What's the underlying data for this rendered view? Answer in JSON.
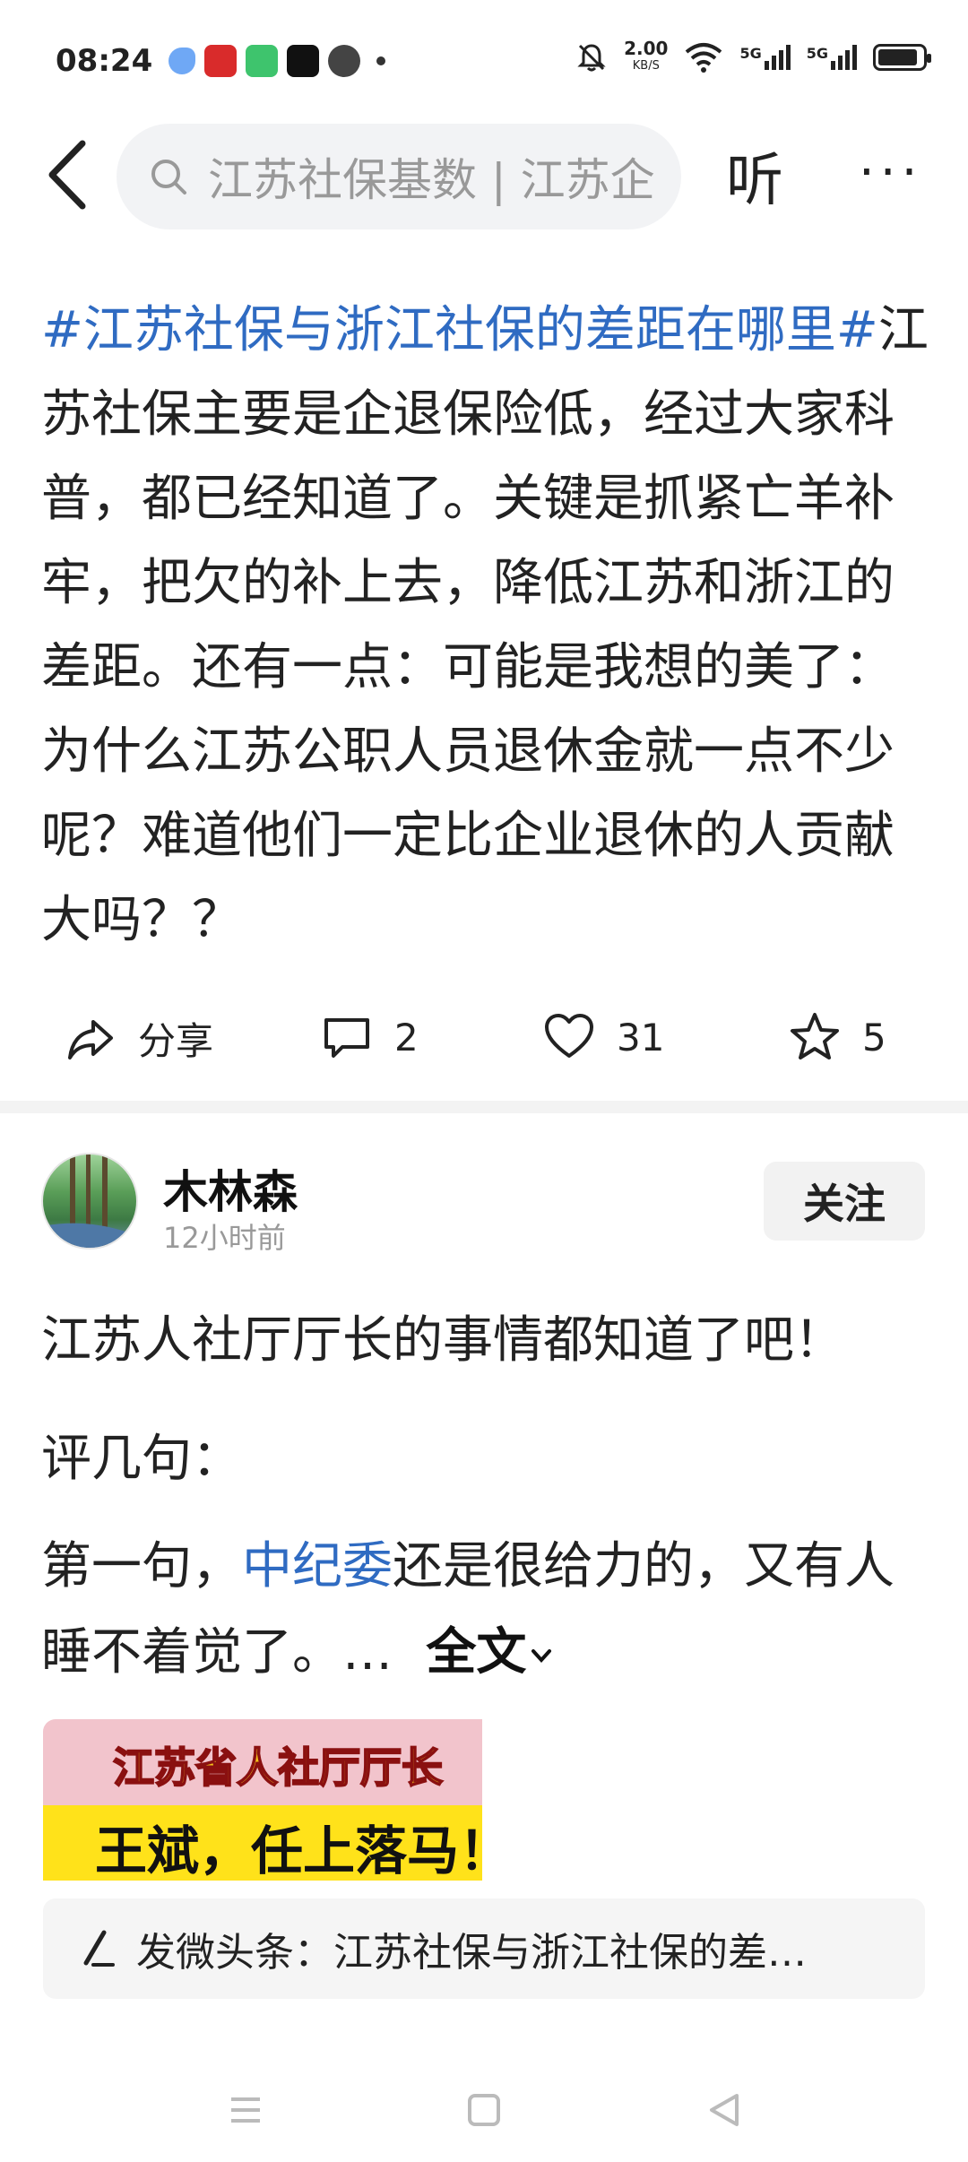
{
  "status_bar": {
    "time": "08:24",
    "net_speed_value": "2.00",
    "net_speed_unit": "KB/S",
    "signal_label_1": "5G",
    "signal_label_2": "5G",
    "battery_level": 0.9
  },
  "top_nav": {
    "search_placeholder": "江苏社保基数 | 江苏企",
    "listen_label": "听",
    "more_label": "···"
  },
  "post": {
    "hashtag": "#江苏社保与浙江社保的差距在哪里#",
    "body": "江苏社保主要是企退保险低，经过大家科普，都已经知道了。关键是抓紧亡羊补牢，把欠的补上去，降低江苏和浙江的差距。还有一点：可能是我想的美了：为什么江苏公职人员退休金就一点不少呢？难道他们一定比企业退休的人贡献大吗？？",
    "actions": {
      "share_label": "分享",
      "comment_count": "2",
      "like_count": "31",
      "favorite_count": "5"
    }
  },
  "feed_item": {
    "username": "木林森",
    "time_ago": "12小时前",
    "follow_label": "关注",
    "line1": "江苏人社厅厅长的事情都知道了吧！",
    "line2": "评几句：",
    "line3_prefix": "第一句，",
    "line3_link": "中纪委",
    "line3_rest": "还是很给力的，又有人睡不着觉了。…",
    "fulltext_label": "全文",
    "thumb_title": "江苏省人社厅厅长",
    "thumb_sub": "王斌，任上落马！"
  },
  "compose_bar": {
    "text": "发微头条：江苏社保与浙江社保的差…"
  }
}
